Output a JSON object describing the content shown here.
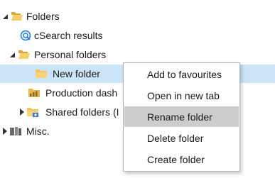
{
  "tree": {
    "items": [
      {
        "label": "Folders",
        "icon": "folder-open-icon",
        "state": "expanded"
      },
      {
        "label": "cSearch results",
        "icon": "search-results-icon",
        "state": "leaf"
      },
      {
        "label": "Personal folders",
        "icon": "folder-open-icon",
        "state": "expanded"
      },
      {
        "label": "New folder",
        "icon": "folder-icon",
        "state": "leaf",
        "selected": true
      },
      {
        "label": "Production dash",
        "icon": "dashboard-icon",
        "state": "leaf"
      },
      {
        "label": "Shared folders (I",
        "icon": "shared-folder-icon",
        "state": "collapsed"
      },
      {
        "label": "Misc.",
        "icon": "misc-icon",
        "state": "collapsed"
      }
    ]
  },
  "context_menu": {
    "items": [
      {
        "label": "Add to favourites"
      },
      {
        "label": "Open in new tab"
      },
      {
        "label": "Rename folder",
        "highlighted": true
      },
      {
        "label": "Delete folder"
      },
      {
        "label": "Create folder"
      }
    ]
  },
  "colors": {
    "selection": "#cce4f7",
    "menu_highlight": "#cccccc",
    "folder": "#f2c45c",
    "accent": "#1e74c6"
  }
}
